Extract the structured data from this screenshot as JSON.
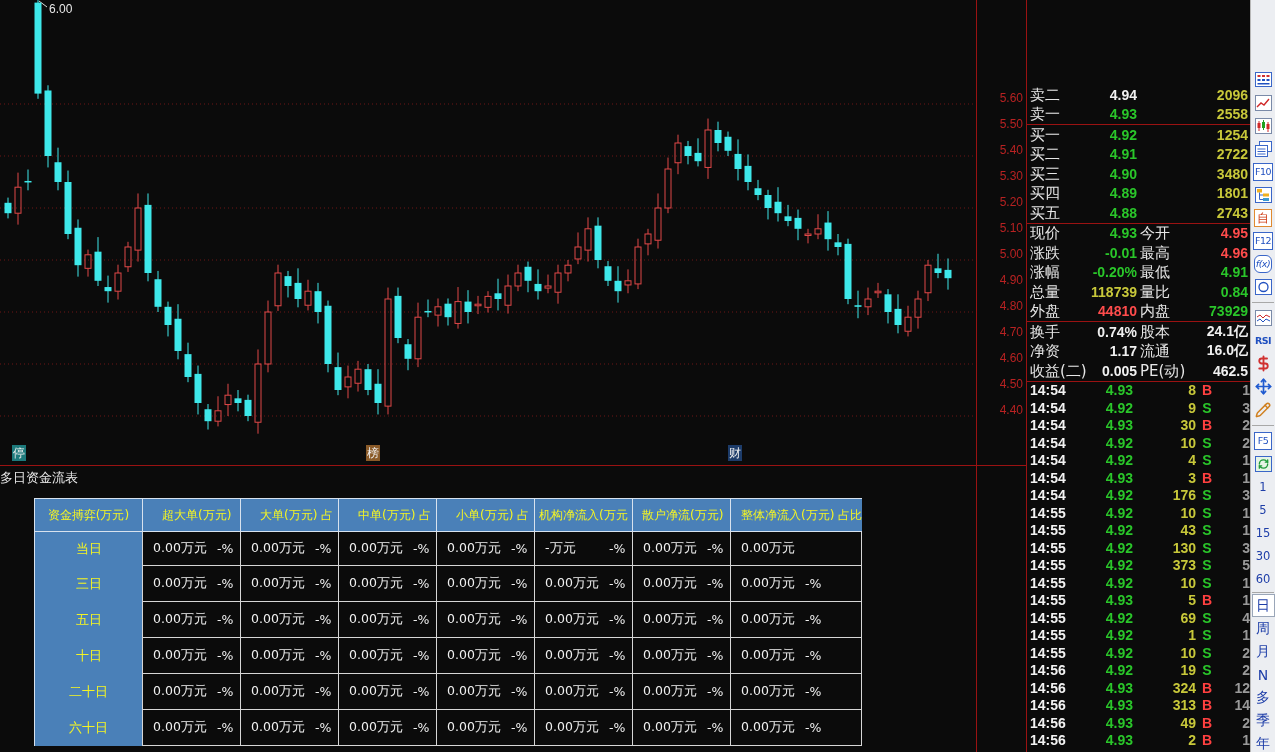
{
  "chart": {
    "high_label": "6.00",
    "price_axis": [
      "5.60",
      "5.50",
      "5.40",
      "5.30",
      "5.20",
      "5.10",
      "5.00",
      "4.90",
      "4.80",
      "4.70",
      "4.60",
      "4.50",
      "4.40"
    ],
    "markers": [
      {
        "label": "停",
        "color": "#1d7a7c"
      },
      {
        "label": "榜",
        "color": "#8a5a28"
      },
      {
        "label": "财",
        "color": "#1d3c6a"
      }
    ]
  },
  "fund_flow": {
    "title": "多日资金流表",
    "corner": "资金搏弈(万元)",
    "columns": [
      "超大单(万元)",
      "大单(万元) 占",
      "中单(万元) 占",
      "小单(万元) 占",
      "机构净流入(万元",
      "散户净流(万元)",
      "整体净流入(万元) 占比"
    ],
    "rows": [
      {
        "label": "当日",
        "cells": [
          {
            "amount": "0.00万元",
            "share": "-%"
          },
          {
            "amount": "0.00万元",
            "share": "-%"
          },
          {
            "amount": "0.00万元",
            "share": "-%"
          },
          {
            "amount": "0.00万元",
            "share": "-%"
          },
          {
            "amount": "-万元",
            "share": "-%"
          },
          {
            "amount": "0.00万元",
            "share": "-%"
          },
          {
            "amount": "0.00万元"
          }
        ]
      },
      {
        "label": "三日",
        "cells": [
          {
            "amount": "0.00万元",
            "share": "-%"
          },
          {
            "amount": "0.00万元",
            "share": "-%"
          },
          {
            "amount": "0.00万元",
            "share": "-%"
          },
          {
            "amount": "0.00万元",
            "share": "-%"
          },
          {
            "amount": "0.00万元",
            "share": "-%"
          },
          {
            "amount": "0.00万元",
            "share": "-%"
          },
          {
            "amount": "0.00万元",
            "share": "-%"
          }
        ]
      },
      {
        "label": "五日",
        "cells": [
          {
            "amount": "0.00万元",
            "share": "-%"
          },
          {
            "amount": "0.00万元",
            "share": "-%"
          },
          {
            "amount": "0.00万元",
            "share": "-%"
          },
          {
            "amount": "0.00万元",
            "share": "-%"
          },
          {
            "amount": "0.00万元",
            "share": "-%"
          },
          {
            "amount": "0.00万元",
            "share": "-%"
          },
          {
            "amount": "0.00万元",
            "share": "-%"
          }
        ]
      },
      {
        "label": "十日",
        "cells": [
          {
            "amount": "0.00万元",
            "share": "-%"
          },
          {
            "amount": "0.00万元",
            "share": "-%"
          },
          {
            "amount": "0.00万元",
            "share": "-%"
          },
          {
            "amount": "0.00万元",
            "share": "-%"
          },
          {
            "amount": "0.00万元",
            "share": "-%"
          },
          {
            "amount": "0.00万元",
            "share": "-%"
          },
          {
            "amount": "0.00万元",
            "share": "-%"
          }
        ]
      },
      {
        "label": "二十日",
        "cells": [
          {
            "amount": "0.00万元",
            "share": "-%"
          },
          {
            "amount": "0.00万元",
            "share": "-%"
          },
          {
            "amount": "0.00万元",
            "share": "-%"
          },
          {
            "amount": "0.00万元",
            "share": "-%"
          },
          {
            "amount": "0.00万元",
            "share": "-%"
          },
          {
            "amount": "0.00万元",
            "share": "-%"
          },
          {
            "amount": "0.00万元",
            "share": "-%"
          }
        ]
      },
      {
        "label": "六十日",
        "cells": [
          {
            "amount": "0.00万元",
            "share": "-%"
          },
          {
            "amount": "0.00万元",
            "share": "-%"
          },
          {
            "amount": "0.00万元",
            "share": "-%"
          },
          {
            "amount": "0.00万元",
            "share": "-%"
          },
          {
            "amount": "0.00万元",
            "share": "-%"
          },
          {
            "amount": "0.00万元",
            "share": "-%"
          },
          {
            "amount": "0.00万元",
            "share": "-%"
          }
        ]
      }
    ]
  },
  "quotes": {
    "asks": [
      {
        "label": "卖二",
        "price": "4.94",
        "volume": "2096",
        "color": "#f0f0f0"
      },
      {
        "label": "卖一",
        "price": "4.93",
        "volume": "2558",
        "color": "#2ac62a"
      }
    ],
    "bids": [
      {
        "label": "买一",
        "price": "4.92",
        "volume": "1254",
        "color": "#2ac62a"
      },
      {
        "label": "买二",
        "price": "4.91",
        "volume": "2722",
        "color": "#2ac62a"
      },
      {
        "label": "买三",
        "price": "4.90",
        "volume": "3480",
        "color": "#2ac62a"
      },
      {
        "label": "买四",
        "price": "4.89",
        "volume": "1801",
        "color": "#2ac62a"
      },
      {
        "label": "买五",
        "price": "4.88",
        "volume": "2743",
        "color": "#2ac62a"
      }
    ],
    "stats": [
      {
        "left": {
          "label": "现价",
          "value": "4.93",
          "color": "#2ac62a"
        },
        "right": {
          "label": "今开",
          "value": "4.95",
          "color": "#ff4c4c"
        }
      },
      {
        "left": {
          "label": "涨跌",
          "value": "-0.01",
          "color": "#2ac62a"
        },
        "right": {
          "label": "最高",
          "value": "4.96",
          "color": "#ff4c4c"
        }
      },
      {
        "left": {
          "label": "涨幅",
          "value": "-0.20%",
          "color": "#2ac62a"
        },
        "right": {
          "label": "最低",
          "value": "4.91",
          "color": "#2ac62a"
        }
      },
      {
        "left": {
          "label": "总量",
          "value": "118739",
          "color": "#c8c83a"
        },
        "right": {
          "label": "量比",
          "value": "0.84",
          "color": "#2ac62a"
        }
      },
      {
        "left": {
          "label": "外盘",
          "value": "44810",
          "color": "#ff4c4c"
        },
        "right": {
          "label": "内盘",
          "value": "73929",
          "color": "#2ac62a"
        }
      }
    ],
    "info": [
      {
        "left": {
          "label": "换手",
          "value": "0.74%",
          "color": "#f0f0f0"
        },
        "right": {
          "label": "股本",
          "value": "24.1亿",
          "color": "#f0f0f0"
        }
      },
      {
        "left": {
          "label": "净资",
          "value": "1.17",
          "color": "#f0f0f0"
        },
        "right": {
          "label": "流通",
          "value": "16.0亿",
          "color": "#f0f0f0"
        }
      },
      {
        "left": {
          "label": "收益(二)",
          "value": "0.005",
          "color": "#f0f0f0"
        },
        "right": {
          "label": "PE(动)",
          "value": "462.5",
          "color": "#f0f0f0"
        }
      }
    ]
  },
  "trades": [
    {
      "time": "14:54",
      "price": "4.93",
      "volume": "8",
      "side": "B",
      "color": "#ff4040",
      "count": "1"
    },
    {
      "time": "14:54",
      "price": "4.92",
      "volume": "9",
      "side": "S",
      "color": "#2ac62a",
      "count": "3"
    },
    {
      "time": "14:54",
      "price": "4.93",
      "volume": "30",
      "side": "B",
      "color": "#ff4040",
      "count": "2"
    },
    {
      "time": "14:54",
      "price": "4.92",
      "volume": "10",
      "side": "S",
      "color": "#2ac62a",
      "count": "2"
    },
    {
      "time": "14:54",
      "price": "4.92",
      "volume": "4",
      "side": "S",
      "color": "#2ac62a",
      "count": "1"
    },
    {
      "time": "14:54",
      "price": "4.93",
      "volume": "3",
      "side": "B",
      "color": "#ff4040",
      "count": "1"
    },
    {
      "time": "14:54",
      "price": "4.92",
      "volume": "176",
      "side": "S",
      "color": "#2ac62a",
      "count": "3"
    },
    {
      "time": "14:55",
      "price": "4.92",
      "volume": "10",
      "side": "S",
      "color": "#2ac62a",
      "count": "1"
    },
    {
      "time": "14:55",
      "price": "4.92",
      "volume": "43",
      "side": "S",
      "color": "#2ac62a",
      "count": "1"
    },
    {
      "time": "14:55",
      "price": "4.92",
      "volume": "130",
      "side": "S",
      "color": "#2ac62a",
      "count": "3"
    },
    {
      "time": "14:55",
      "price": "4.92",
      "volume": "373",
      "side": "S",
      "color": "#2ac62a",
      "count": "5"
    },
    {
      "time": "14:55",
      "price": "4.92",
      "volume": "10",
      "side": "S",
      "color": "#2ac62a",
      "count": "1"
    },
    {
      "time": "14:55",
      "price": "4.93",
      "volume": "5",
      "side": "B",
      "color": "#ff4040",
      "count": "1"
    },
    {
      "time": "14:55",
      "price": "4.92",
      "volume": "69",
      "side": "S",
      "color": "#2ac62a",
      "count": "4"
    },
    {
      "time": "14:55",
      "price": "4.92",
      "volume": "1",
      "side": "S",
      "color": "#2ac62a",
      "count": "1"
    },
    {
      "time": "14:55",
      "price": "4.92",
      "volume": "10",
      "side": "S",
      "color": "#2ac62a",
      "count": "2"
    },
    {
      "time": "14:56",
      "price": "4.92",
      "volume": "19",
      "side": "S",
      "color": "#2ac62a",
      "count": "2"
    },
    {
      "time": "14:56",
      "price": "4.93",
      "volume": "324",
      "side": "B",
      "color": "#ff4040",
      "count": "12"
    },
    {
      "time": "14:56",
      "price": "4.93",
      "volume": "313",
      "side": "B",
      "color": "#ff4040",
      "count": "14"
    },
    {
      "time": "14:56",
      "price": "4.93",
      "volume": "49",
      "side": "B",
      "color": "#ff4040",
      "count": "2"
    },
    {
      "time": "14:56",
      "price": "4.93",
      "volume": "2",
      "side": "B",
      "color": "#ff4040",
      "count": "1"
    }
  ],
  "toolbar": {
    "labels": [
      "F10",
      "自",
      "F12",
      "f(x)",
      "RSI",
      "F5"
    ],
    "intraday_periods": [
      {
        "label": "1",
        "selected": false
      },
      {
        "label": "5",
        "selected": false
      },
      {
        "label": "15",
        "selected": false
      },
      {
        "label": "30",
        "selected": false
      },
      {
        "label": "60",
        "selected": false
      }
    ],
    "periods": [
      {
        "label": "日",
        "selected": true
      },
      {
        "label": "周",
        "selected": false
      },
      {
        "label": "月",
        "selected": false
      },
      {
        "label": "N",
        "selected": false
      },
      {
        "label": "多",
        "selected": false
      },
      {
        "label": "季",
        "selected": false
      },
      {
        "label": "年",
        "selected": false
      }
    ]
  }
}
